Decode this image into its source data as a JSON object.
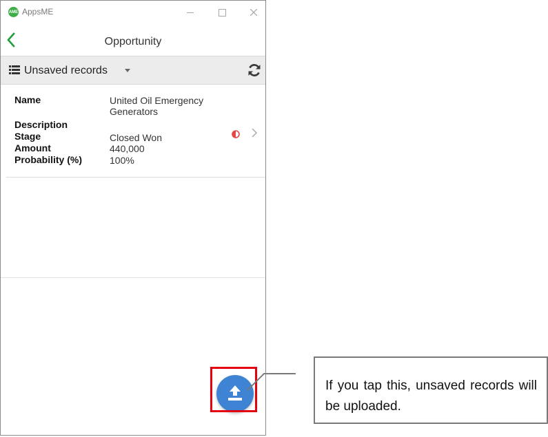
{
  "window": {
    "app_logo_text": "AME",
    "app_title": "AppsME",
    "controls": [
      "minimize",
      "maximize",
      "close"
    ]
  },
  "header": {
    "title": "Opportunity",
    "back_icon": "chevron-left-icon"
  },
  "filter_bar": {
    "label": "Unsaved records",
    "list_icon": "list-icon",
    "dropdown_icon": "caret-down-icon",
    "refresh_icon": "refresh-icon"
  },
  "record": {
    "fields": [
      {
        "label": "Name",
        "value": "United Oil Emergency Generators"
      },
      {
        "label": "Description",
        "value": ""
      },
      {
        "label": "Stage",
        "value": "Closed Won"
      },
      {
        "label": "Amount",
        "value": "440,000"
      },
      {
        "label": "Probability (%)",
        "value": "100%"
      }
    ],
    "status_icon": "half-circle-warning-icon",
    "open_icon": "chevron-right-icon"
  },
  "upload_button": {
    "icon": "upload-icon"
  },
  "callout": {
    "text": "If you tap this, unsaved records will be uploaded."
  },
  "colors": {
    "accent_green": "#3fae49",
    "fab_blue": "#3f84d4",
    "highlight_red": "#e3000f",
    "warning_red": "#e84545"
  }
}
